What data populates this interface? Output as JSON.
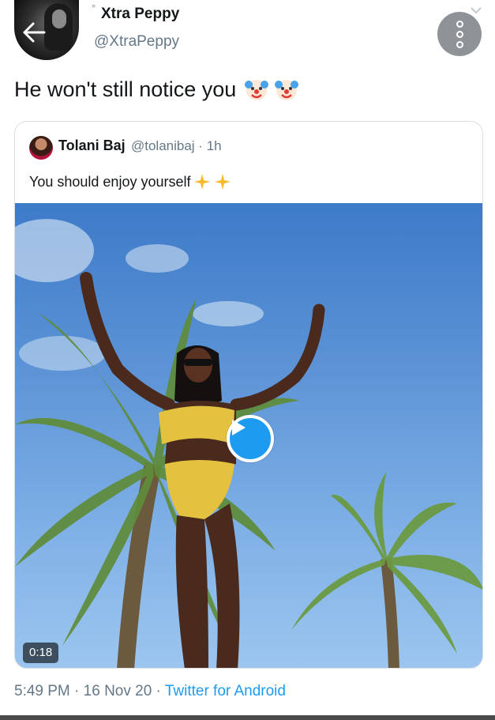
{
  "header": {
    "display_name": "Xtra Peppy",
    "handle": "@XtraPeppy",
    "back_icon": "arrow-left-icon",
    "more_icon": "more-vertical-icon"
  },
  "tweet": {
    "text": "He won't still notice you",
    "emojis": [
      "clown-face-emoji",
      "clown-face-emoji"
    ]
  },
  "quoted_tweet": {
    "author_name": "Tolani Baj",
    "handle_time": "@tolanibaj · 1h",
    "text": "You should enjoy yourself",
    "emojis": [
      "sparkles-emoji",
      "sparkles-emoji"
    ],
    "video_duration": "0:18"
  },
  "meta": {
    "time": "5:49 PM",
    "sep1": " · ",
    "date": "16 Nov 20",
    "sep2": " · ",
    "source": "Twitter for Android"
  },
  "colors": {
    "accent": "#1d9bf0",
    "secondary_text": "#657786",
    "primary_text": "#14171a"
  }
}
